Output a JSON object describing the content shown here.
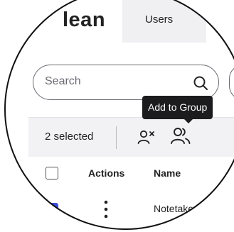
{
  "header": {
    "brand_partial": "lean",
    "tabs": [
      {
        "label": "Users"
      }
    ]
  },
  "search": {
    "placeholder": "Search",
    "icon": "search-icon"
  },
  "tooltip": {
    "text": "Add to Group"
  },
  "selection_toolbar": {
    "selected_count_label": "2 selected",
    "icons": [
      "remove-user-icon",
      "add-to-group-icon"
    ]
  },
  "table": {
    "columns": [
      "Actions",
      "Name"
    ],
    "rows": [
      {
        "name": "Notetake",
        "checked": true
      }
    ]
  },
  "colors": {
    "accent": "#3d4fd6",
    "tooltip_bg": "#1c1c1f",
    "toolbar_bg": "#f2f2f5",
    "tab_active_bg": "#f0f0f3"
  }
}
